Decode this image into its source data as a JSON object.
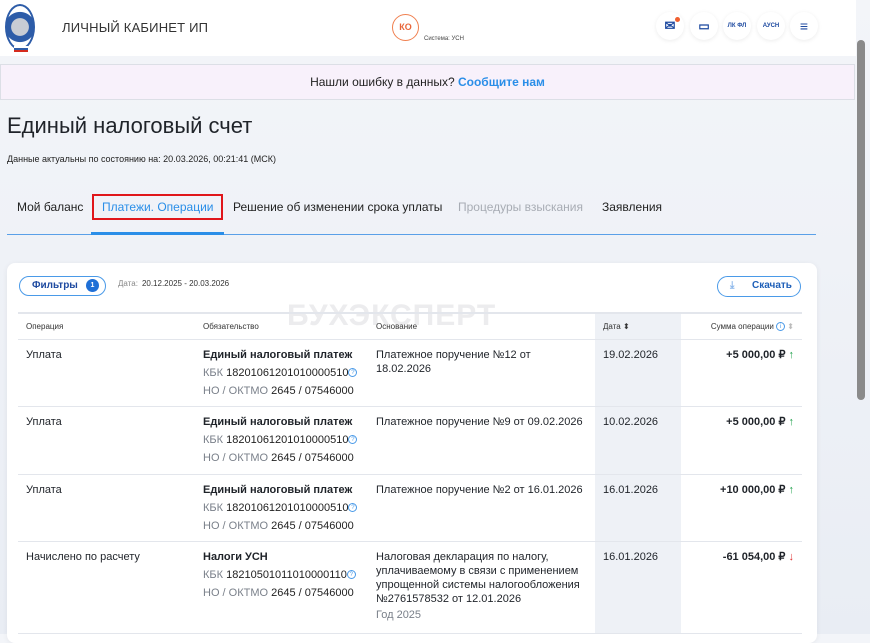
{
  "header": {
    "title": "ЛИЧНЫЙ КАБИНЕТ ИП",
    "avatar": "КО",
    "system": "Система: УСН",
    "btn_lkfl": "ЛК ФЛ",
    "btn_ausn": "АУСН"
  },
  "banner": {
    "text": "Нашли ошибку в данных?",
    "link": "Сообщите нам"
  },
  "page": {
    "title": "Единый налоговый счет",
    "as_of": "Данные актуальны по состоянию на: 20.03.2026, 00:21:41 (МСК)"
  },
  "tabs": [
    "Мой баланс",
    "Платежи. Операции",
    "Решение об изменении срока уплаты",
    "Процедуры взыскания",
    "Заявления"
  ],
  "toolbar": {
    "filters": "Фильтры",
    "filters_count": "1",
    "date_label": "Дата:",
    "date_range": "20.12.2025 - 20.03.2026",
    "download": "Скачать"
  },
  "watermark": "БУХЭКСПЕРТ",
  "columns": [
    "Операция",
    "Обязательство",
    "Основание",
    "Дата",
    "Сумма операции"
  ],
  "rows": [
    {
      "operation": "Уплата",
      "obligation": "Единый налоговый платеж",
      "kbk_label": "КБК",
      "kbk": "18201061201010000510",
      "no_label": "НО / ОКТМО",
      "no": "2645 / 07546000",
      "basis": "Платежное поручение №12 от 18.02.2026",
      "year": "",
      "date": "19.02.2026",
      "amount": "+5 000,00 ₽",
      "dir": "up"
    },
    {
      "operation": "Уплата",
      "obligation": "Единый налоговый платеж",
      "kbk_label": "КБК",
      "kbk": "18201061201010000510",
      "no_label": "НО / ОКТМО",
      "no": "2645 / 07546000",
      "basis": "Платежное поручение №9 от 09.02.2026",
      "year": "",
      "date": "10.02.2026",
      "amount": "+5 000,00 ₽",
      "dir": "up"
    },
    {
      "operation": "Уплата",
      "obligation": "Единый налоговый платеж",
      "kbk_label": "КБК",
      "kbk": "18201061201010000510",
      "no_label": "НО / ОКТМО",
      "no": "2645 / 07546000",
      "basis": "Платежное поручение №2 от 16.01.2026",
      "year": "",
      "date": "16.01.2026",
      "amount": "+10 000,00 ₽",
      "dir": "up"
    },
    {
      "operation": "Начислено по расчету",
      "obligation": "Налоги УСН",
      "kbk_label": "КБК",
      "kbk": "18210501011010000110",
      "no_label": "НО / ОКТМО",
      "no": "2645 / 07546000",
      "basis": "Налоговая декларация по налогу, уплачиваемому в связи с применением упрощенной системы налогообложения №2761578532 от 12.01.2026",
      "year": "Год 2025",
      "date": "16.01.2026",
      "amount": "-61 054,00 ₽",
      "dir": "down"
    }
  ]
}
